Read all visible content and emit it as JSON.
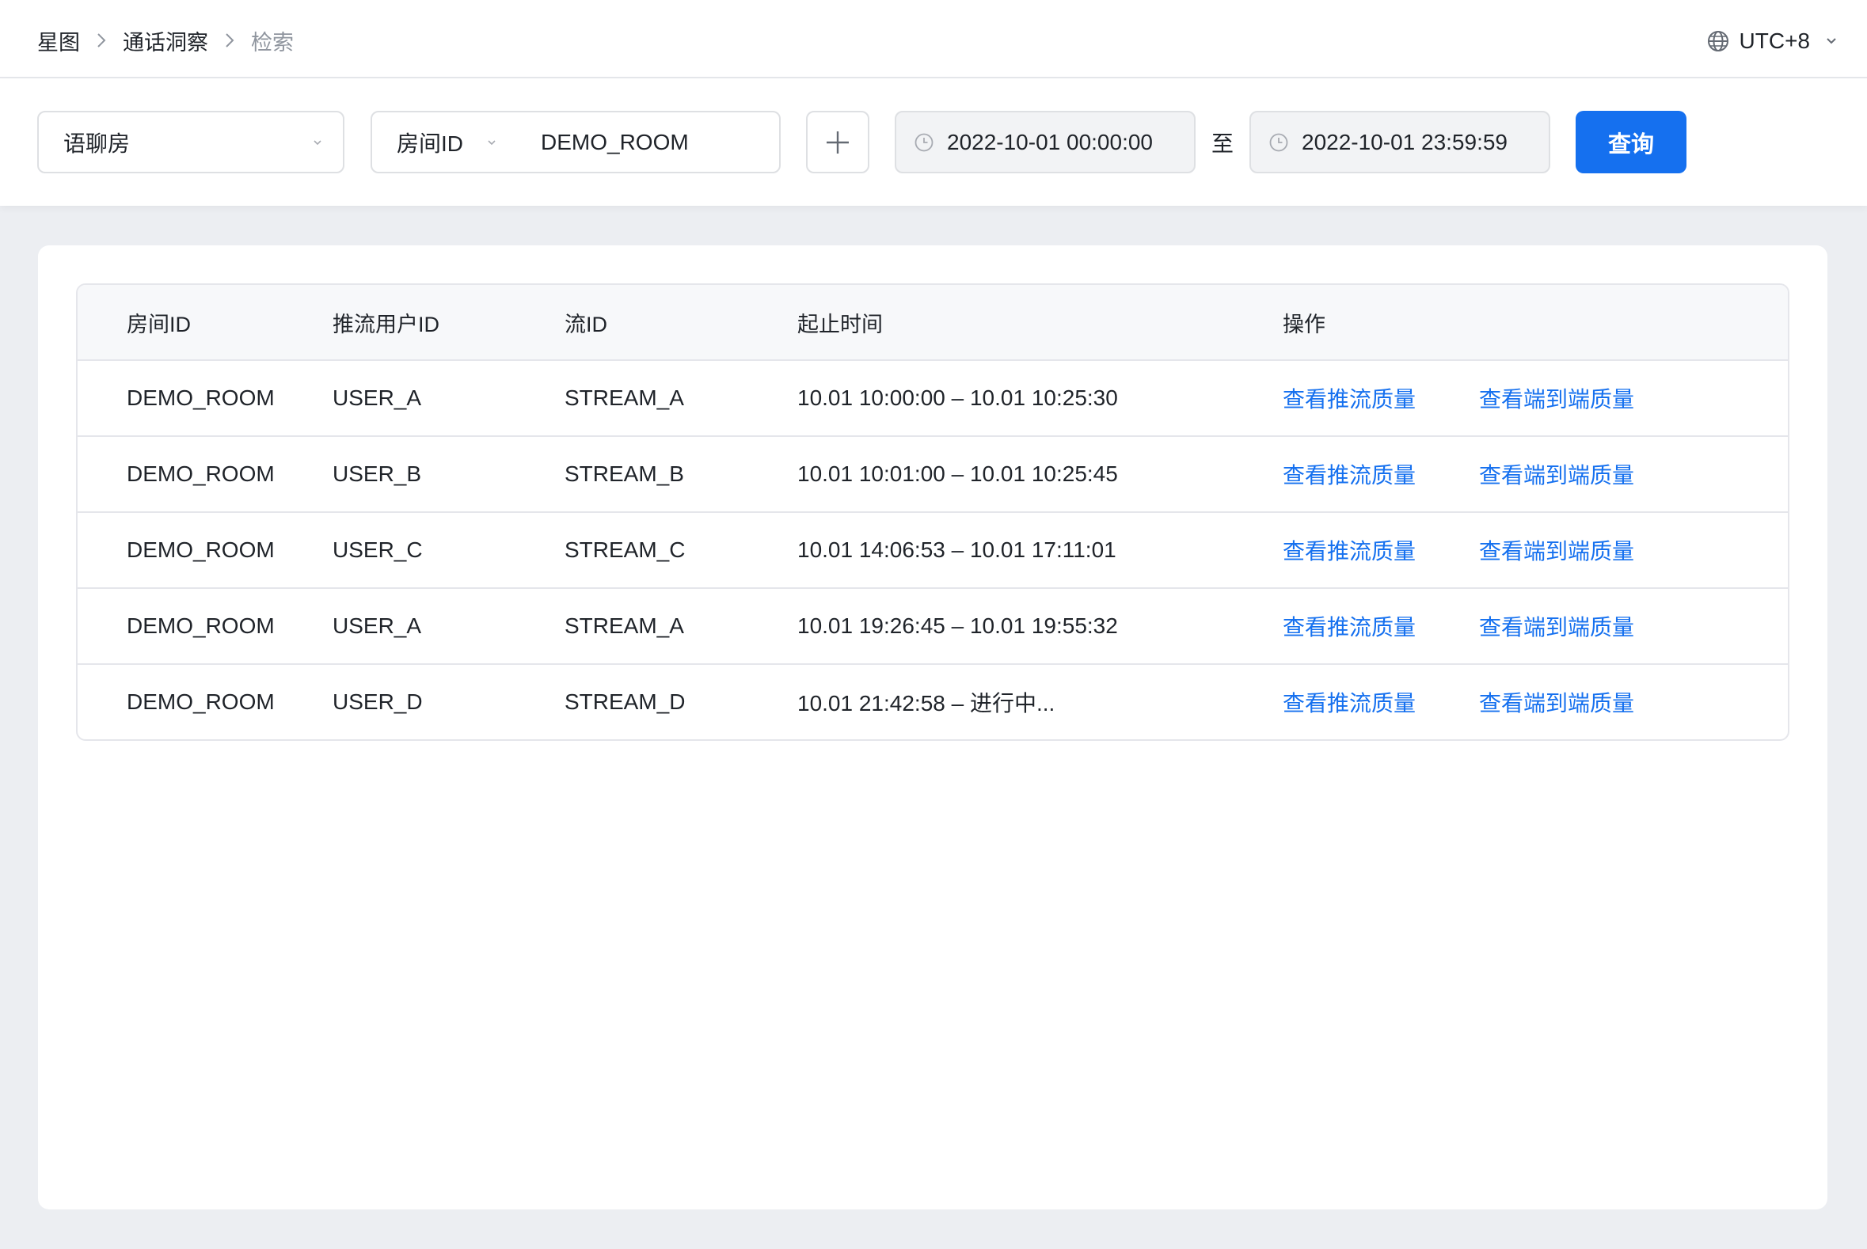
{
  "header": {
    "breadcrumb": [
      "星图",
      "通话洞察",
      "检索"
    ],
    "timezone": "UTC+8"
  },
  "filters": {
    "scene": "语聊房",
    "room_key_label": "房间ID",
    "room_value": "DEMO_ROOM",
    "start_time": "2022-10-01 00:00:00",
    "to_label": "至",
    "end_time": "2022-10-01 23:59:59",
    "query_label": "查询"
  },
  "table": {
    "columns": [
      "房间ID",
      "推流用户ID",
      "流ID",
      "起止时间",
      "操作"
    ],
    "rows": [
      {
        "room": "DEMO_ROOM",
        "user": "USER_A",
        "stream": "STREAM_A",
        "time": "10.01 10:00:00 – 10.01 10:25:30",
        "action1": "查看推流质量",
        "action2": "查看端到端质量"
      },
      {
        "room": "DEMO_ROOM",
        "user": "USER_B",
        "stream": "STREAM_B",
        "time": "10.01 10:01:00 – 10.01 10:25:45",
        "action1": "查看推流质量",
        "action2": "查看端到端质量"
      },
      {
        "room": "DEMO_ROOM",
        "user": "USER_C",
        "stream": "STREAM_C",
        "time": "10.01 14:06:53 – 10.01 17:11:01",
        "action1": "查看推流质量",
        "action2": "查看端到端质量"
      },
      {
        "room": "DEMO_ROOM",
        "user": "USER_A",
        "stream": "STREAM_A",
        "time": "10.01 19:26:45 – 10.01 19:55:32",
        "action1": "查看推流质量",
        "action2": "查看端到端质量"
      },
      {
        "room": "DEMO_ROOM",
        "user": "USER_D",
        "stream": "STREAM_D",
        "time": "10.01 21:42:58 – 进行中...",
        "action1": "查看推流质量",
        "action2": "查看端到端质量"
      }
    ]
  },
  "icons": {
    "breadcrumb_separator": "chevron-right-icon",
    "timezone": "globe-icon",
    "dropdown": "chevron-down-icon",
    "add": "plus-icon",
    "time": "clock-icon"
  },
  "colors": {
    "accent": "#1570ef",
    "page_bg": "#eceef2",
    "muted_text": "#8f959e"
  }
}
